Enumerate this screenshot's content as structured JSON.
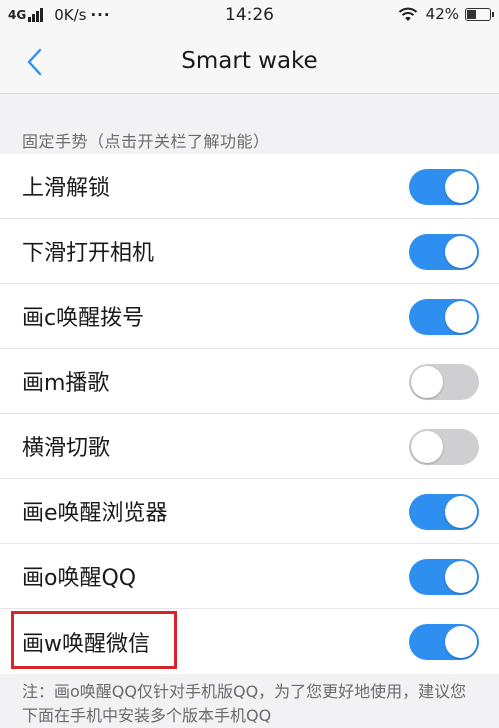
{
  "status_bar": {
    "network": "4G",
    "speed": "0K/s",
    "dots": "···",
    "time": "14:26",
    "battery_text": "42%",
    "battery_level": 0.42
  },
  "nav": {
    "title": "Smart wake"
  },
  "section": {
    "header": "固定手势（点击开关栏了解功能）"
  },
  "gestures": [
    {
      "label": "上滑解锁",
      "on": true
    },
    {
      "label": "下滑打开相机",
      "on": true
    },
    {
      "label": "画c唤醒拨号",
      "on": true
    },
    {
      "label": "画m播歌",
      "on": false
    },
    {
      "label": "横滑切歌",
      "on": false
    },
    {
      "label": "画e唤醒浏览器",
      "on": true
    },
    {
      "label": "画o唤醒QQ",
      "on": true
    },
    {
      "label": "画w唤醒微信",
      "on": true
    }
  ],
  "note": "注：画o唤醒QQ仅针对手机版QQ，为了您更好地使用，建议您下面在手机中安装多个版本手机QQ",
  "colors": {
    "toggle_on": "#2f8ff0",
    "toggle_off": "#cfcfd1",
    "highlight": "#d8242c",
    "accent": "#2f8ff0"
  }
}
